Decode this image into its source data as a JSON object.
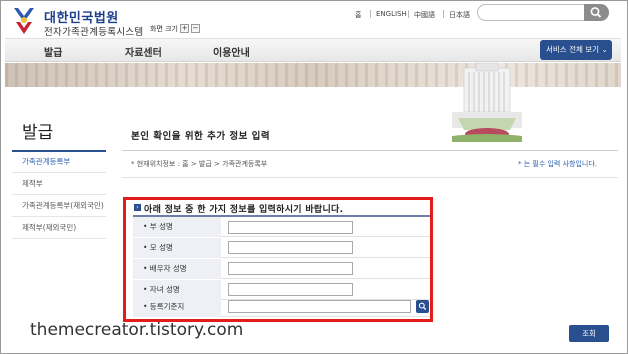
{
  "header": {
    "org_name": "대한민국법원",
    "system_name": "전자가족관계등록시스템",
    "font_size_label": "화면 크기",
    "font_size_plus": "+",
    "font_size_minus": "−",
    "util_links": [
      "홈",
      "ENGLISH",
      "中國語",
      "日本語"
    ],
    "search": {
      "value": "",
      "icon": "search-icon"
    }
  },
  "nav": {
    "items": [
      "발급",
      "자료센터",
      "이용안내"
    ],
    "service_all_label": "서비스 전체 보기 ⌄"
  },
  "sidebar": {
    "title": "발급",
    "items": [
      {
        "label": "가족관계등록부",
        "active": true
      },
      {
        "label": "제적부",
        "active": false
      },
      {
        "label": "가족관계등록부(재외국민)",
        "active": false
      },
      {
        "label": "제적부(재외국민)",
        "active": false
      }
    ]
  },
  "content": {
    "title": "본인 확인을 위한 추가 정보 입력",
    "breadcrumb": "* 현재위치정보 : 홈 > 발급 > 가족관계등록부",
    "required_note": "* 는 필수 입력 사항입니다.",
    "section_title": "아래 정보 중 한 가지 정보를 입력하시기 바랍니다.",
    "fields": [
      {
        "label": "• 부 성명",
        "value": ""
      },
      {
        "label": "• 모 성명",
        "value": ""
      },
      {
        "label": "• 배우자 성명",
        "value": ""
      },
      {
        "label": "• 자녀 성명",
        "value": ""
      },
      {
        "label": "• 등록기준지",
        "value": ""
      }
    ],
    "submit_label": "조회"
  },
  "watermark": "themecreator.tistory.com",
  "colors": {
    "primary_blue": "#2a4f8f",
    "link_blue": "#2a62b5",
    "highlight_red": "#e31b1b"
  }
}
